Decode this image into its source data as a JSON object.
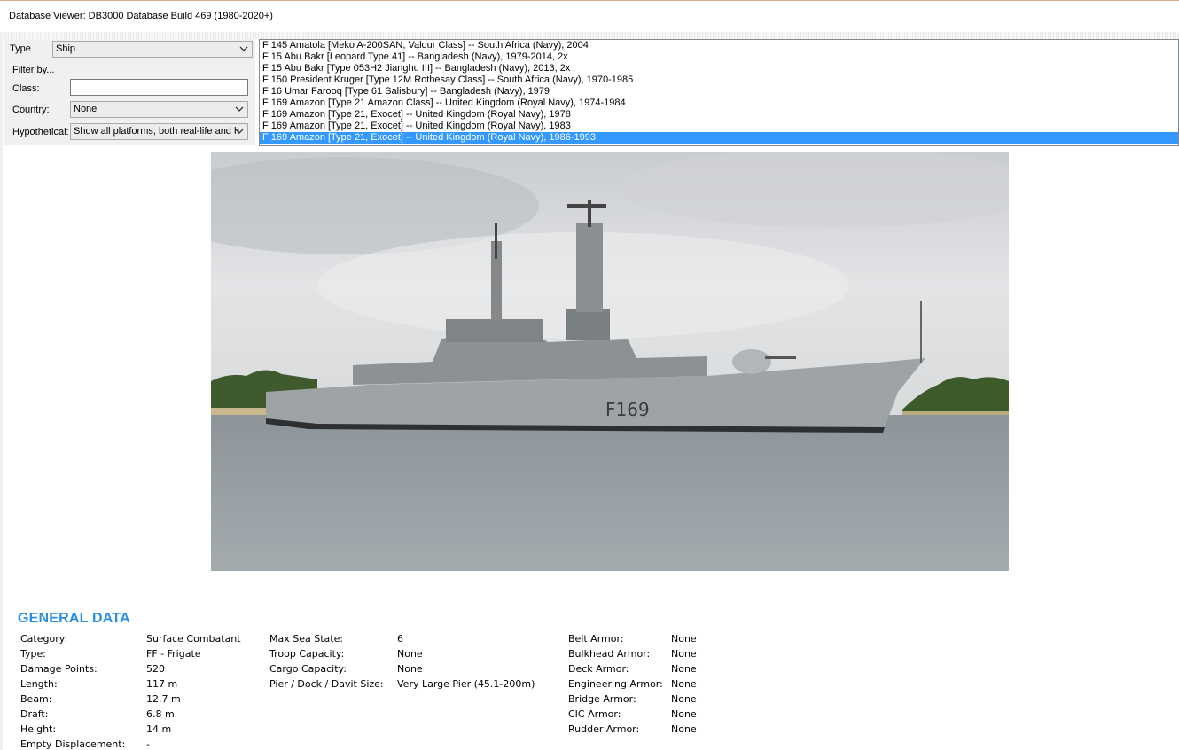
{
  "window": {
    "title": "Database Viewer: DB3000 Database Build 469 (1980-2020+)"
  },
  "filters": {
    "type_label": "Type",
    "type_value": "Ship",
    "filter_by_label": "Filter by...",
    "class_label": "Class:",
    "class_value": "",
    "country_label": "Country:",
    "country_value": "None",
    "hypothetical_label": "Hypothetical:",
    "hypothetical_value": "Show all platforms, both real-life and h"
  },
  "platform_list": {
    "items": [
      "F 145 Amatola [Meko A-200SAN, Valour Class] -- South Africa (Navy), 2004",
      "F 15 Abu Bakr [Leopard Type 41] -- Bangladesh (Navy), 1979-2014, 2x",
      "F 15 Abu Bakr [Type 053H2 Jianghu III] -- Bangladesh (Navy), 2013, 2x",
      "F 150 President Kruger [Type 12M Rothesay Class] -- South Africa (Navy), 1970-1985",
      "F 16 Umar Farooq [Type 61 Salisbury] -- Bangladesh (Navy), 1979",
      "F 169 Amazon [Type 21 Amazon Class] -- United Kingdom (Royal Navy), 1974-1984",
      "F 169 Amazon [Type 21, Exocet] -- United Kingdom (Royal Navy), 1978",
      "F 169 Amazon [Type 21, Exocet] -- United Kingdom (Royal Navy), 1983",
      "F 169 Amazon [Type 21, Exocet] -- United Kingdom (Royal Navy), 1986-1993"
    ],
    "selected_index": 8
  },
  "photo": {
    "hull_number": "F169"
  },
  "general_data": {
    "heading": "GENERAL DATA",
    "col1": [
      {
        "label": "Category:",
        "value": "Surface Combatant"
      },
      {
        "label": "Type:",
        "value": "FF - Frigate"
      },
      {
        "label": "Damage Points:",
        "value": "520"
      },
      {
        "label": "Length:",
        "value": "117 m"
      },
      {
        "label": "Beam:",
        "value": "12.7 m"
      },
      {
        "label": "Draft:",
        "value": "6.8 m"
      },
      {
        "label": "Height:",
        "value": "14 m"
      },
      {
        "label": "Empty Displacement:",
        "value": "-"
      }
    ],
    "col2": [
      {
        "label": "Max Sea State:",
        "value": "6"
      },
      {
        "label": "Troop Capacity:",
        "value": "None"
      },
      {
        "label": "Cargo Capacity:",
        "value": "None"
      },
      {
        "label": "Pier / Dock / Davit Size:",
        "value": "Very Large Pier (45.1-200m)"
      }
    ],
    "col3": [
      {
        "label": "Belt Armor:",
        "value": "None"
      },
      {
        "label": "Bulkhead Armor:",
        "value": "None"
      },
      {
        "label": "Deck Armor:",
        "value": "None"
      },
      {
        "label": "Engineering Armor:",
        "value": "None"
      },
      {
        "label": "Bridge Armor:",
        "value": "None"
      },
      {
        "label": "CIC Armor:",
        "value": "None"
      },
      {
        "label": "Rudder Armor:",
        "value": "None"
      }
    ]
  },
  "colors": {
    "accent": "#2a8fe0",
    "selection": "#3399ff",
    "panel": "#f0f0f0"
  },
  "icons": {
    "dropdown": "chevron-down-icon"
  }
}
